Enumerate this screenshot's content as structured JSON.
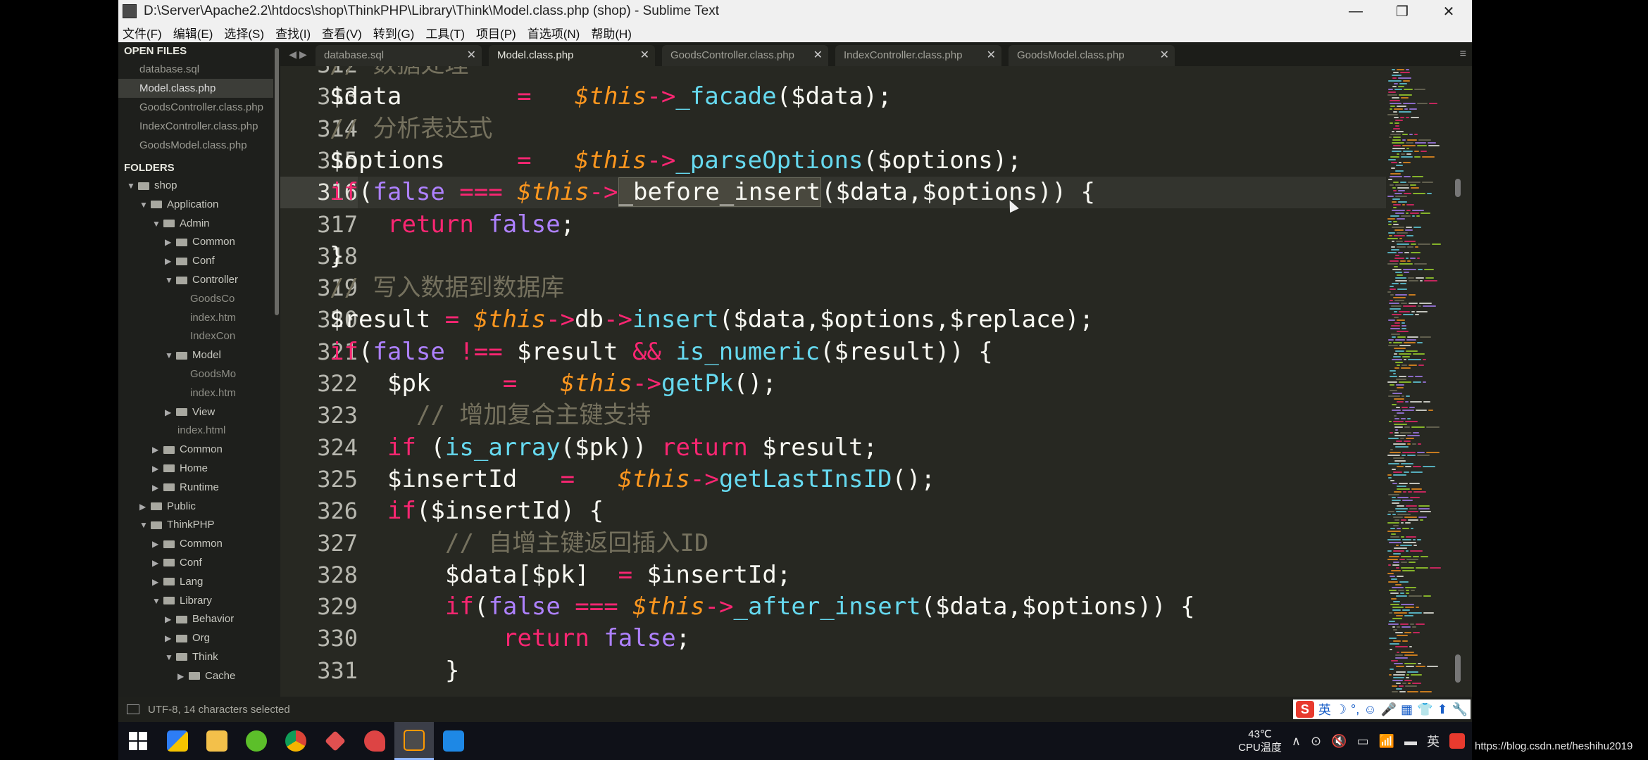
{
  "window": {
    "title": "D:\\Server\\Apache2.2\\htdocs\\shop\\ThinkPHP\\Library\\Think\\Model.class.php (shop) - Sublime Text",
    "controls": [
      "—",
      "❐",
      "✕"
    ]
  },
  "menu": [
    "文件(F)",
    "编辑(E)",
    "选择(S)",
    "查找(I)",
    "查看(V)",
    "转到(G)",
    "工具(T)",
    "项目(P)",
    "首选项(N)",
    "帮助(H)"
  ],
  "sidebar": {
    "open_files_label": "OPEN FILES",
    "open_files": [
      "database.sql",
      "Model.class.php",
      "GoodsController.class.php",
      "IndexController.class.php",
      "GoodsModel.class.php"
    ],
    "active_file_index": 1,
    "folders_label": "FOLDERS",
    "tree": [
      {
        "label": "shop",
        "depth": 0,
        "type": "folder",
        "expanded": true
      },
      {
        "label": "Application",
        "depth": 1,
        "type": "folder",
        "expanded": true
      },
      {
        "label": "Admin",
        "depth": 2,
        "type": "folder",
        "expanded": true
      },
      {
        "label": "Common",
        "depth": 3,
        "type": "folder",
        "expanded": false
      },
      {
        "label": "Conf",
        "depth": 3,
        "type": "folder",
        "expanded": false
      },
      {
        "label": "Controller",
        "depth": 3,
        "type": "folder",
        "expanded": true
      },
      {
        "label": "GoodsCo",
        "depth": 5,
        "type": "file"
      },
      {
        "label": "index.htm",
        "depth": 5,
        "type": "file"
      },
      {
        "label": "IndexCon",
        "depth": 5,
        "type": "file"
      },
      {
        "label": "Model",
        "depth": 3,
        "type": "folder",
        "expanded": true
      },
      {
        "label": "GoodsMo",
        "depth": 5,
        "type": "file"
      },
      {
        "label": "index.htm",
        "depth": 5,
        "type": "file"
      },
      {
        "label": "View",
        "depth": 3,
        "type": "folder",
        "expanded": false
      },
      {
        "label": "index.html",
        "depth": 4,
        "type": "file"
      },
      {
        "label": "Common",
        "depth": 2,
        "type": "folder",
        "expanded": false
      },
      {
        "label": "Home",
        "depth": 2,
        "type": "folder",
        "expanded": false
      },
      {
        "label": "Runtime",
        "depth": 2,
        "type": "folder",
        "expanded": false
      },
      {
        "label": "Public",
        "depth": 1,
        "type": "folder",
        "expanded": false
      },
      {
        "label": "ThinkPHP",
        "depth": 1,
        "type": "folder",
        "expanded": true
      },
      {
        "label": "Common",
        "depth": 2,
        "type": "folder",
        "expanded": false
      },
      {
        "label": "Conf",
        "depth": 2,
        "type": "folder",
        "expanded": false
      },
      {
        "label": "Lang",
        "depth": 2,
        "type": "folder",
        "expanded": false
      },
      {
        "label": "Library",
        "depth": 2,
        "type": "folder",
        "expanded": true
      },
      {
        "label": "Behavior",
        "depth": 3,
        "type": "folder",
        "expanded": false
      },
      {
        "label": "Org",
        "depth": 3,
        "type": "folder",
        "expanded": false
      },
      {
        "label": "Think",
        "depth": 3,
        "type": "folder",
        "expanded": true
      },
      {
        "label": "Cache",
        "depth": 4,
        "type": "folder",
        "expanded": false
      }
    ]
  },
  "tabs": {
    "nav": "◀ ▶",
    "items": [
      "database.sql",
      "Model.class.php",
      "GoodsController.class.php",
      "IndexController.class.php",
      "GoodsModel.class.php"
    ],
    "active_index": 1,
    "close": "✕",
    "menu": "≡"
  },
  "editor": {
    "current_line": 316,
    "lines": [
      {
        "n": "312",
        "indent": 2,
        "tokens": [
          [
            "cm",
            "// 数据处理"
          ]
        ]
      },
      {
        "n": "313",
        "indent": 2,
        "tokens": [
          [
            "",
            "$data        "
          ],
          [
            "kw",
            "="
          ],
          [
            "",
            "   "
          ],
          [
            "th",
            "$this"
          ],
          [
            "kw",
            "->"
          ],
          [
            "fn",
            "_facade"
          ],
          [
            "",
            "($data);"
          ]
        ]
      },
      {
        "n": "314",
        "indent": 2,
        "tokens": [
          [
            "cm",
            "// 分析表达式"
          ]
        ]
      },
      {
        "n": "315",
        "indent": 2,
        "tokens": [
          [
            "",
            "$options     "
          ],
          [
            "kw",
            "="
          ],
          [
            "",
            "   "
          ],
          [
            "th",
            "$this"
          ],
          [
            "kw",
            "->"
          ],
          [
            "fn",
            "_parseOptions"
          ],
          [
            "",
            "($options);"
          ]
        ]
      },
      {
        "n": "316",
        "indent": 2,
        "tokens": [
          [
            "kw",
            "if"
          ],
          [
            "",
            "("
          ],
          [
            "cst",
            "false"
          ],
          [
            "",
            " "
          ],
          [
            "kw",
            "==="
          ],
          [
            "",
            " "
          ],
          [
            "th",
            "$this"
          ],
          [
            "kw",
            "->"
          ],
          [
            "sel",
            "_before_insert"
          ],
          [
            "",
            "($data,$options)) {"
          ]
        ]
      },
      {
        "n": "317",
        "indent": 3,
        "tokens": [
          [
            "kw",
            "return"
          ],
          [
            "",
            " "
          ],
          [
            "cst",
            "false"
          ],
          [
            "",
            ";"
          ]
        ]
      },
      {
        "n": "318",
        "indent": 2,
        "tokens": [
          [
            "",
            "}"
          ]
        ]
      },
      {
        "n": "319",
        "indent": 2,
        "tokens": [
          [
            "cm",
            "// 写入数据到数据库"
          ]
        ]
      },
      {
        "n": "320",
        "indent": 2,
        "tokens": [
          [
            "",
            "$result "
          ],
          [
            "kw",
            "="
          ],
          [
            "",
            " "
          ],
          [
            "th",
            "$this"
          ],
          [
            "kw",
            "->"
          ],
          [
            "",
            "db"
          ],
          [
            "kw",
            "->"
          ],
          [
            "fn",
            "insert"
          ],
          [
            "",
            "($data,$options,$replace);"
          ]
        ]
      },
      {
        "n": "321",
        "indent": 2,
        "tokens": [
          [
            "kw",
            "if"
          ],
          [
            "",
            "("
          ],
          [
            "cst",
            "false"
          ],
          [
            "",
            " "
          ],
          [
            "kw",
            "!=="
          ],
          [
            "",
            " $result "
          ],
          [
            "kw",
            "&&"
          ],
          [
            "",
            " "
          ],
          [
            "fn",
            "is_numeric"
          ],
          [
            "",
            "($result)) {"
          ]
        ]
      },
      {
        "n": "322",
        "indent": 3,
        "tokens": [
          [
            "",
            "$pk     "
          ],
          [
            "kw",
            "="
          ],
          [
            "",
            "   "
          ],
          [
            "th",
            "$this"
          ],
          [
            "kw",
            "->"
          ],
          [
            "fn",
            "getPk"
          ],
          [
            "",
            "();"
          ]
        ]
      },
      {
        "n": "323",
        "indent": 3,
        "tokens": [
          [
            "cm",
            "  // 增加复合主键支持"
          ]
        ]
      },
      {
        "n": "324",
        "indent": 3,
        "tokens": [
          [
            "kw",
            "if"
          ],
          [
            "",
            " ("
          ],
          [
            "fn",
            "is_array"
          ],
          [
            "",
            "($pk)) "
          ],
          [
            "kw",
            "return"
          ],
          [
            "",
            " $result;"
          ]
        ]
      },
      {
        "n": "325",
        "indent": 3,
        "tokens": [
          [
            "",
            "$insertId   "
          ],
          [
            "kw",
            "="
          ],
          [
            "",
            "   "
          ],
          [
            "th",
            "$this"
          ],
          [
            "kw",
            "->"
          ],
          [
            "fn",
            "getLastInsID"
          ],
          [
            "",
            "();"
          ]
        ]
      },
      {
        "n": "326",
        "indent": 3,
        "tokens": [
          [
            "kw",
            "if"
          ],
          [
            "",
            "($insertId) {"
          ]
        ]
      },
      {
        "n": "327",
        "indent": 4,
        "tokens": [
          [
            "cm",
            "// 自增主键返回插入ID"
          ]
        ]
      },
      {
        "n": "328",
        "indent": 4,
        "tokens": [
          [
            "",
            "$data[$pk]  "
          ],
          [
            "kw",
            "="
          ],
          [
            "",
            " $insertId;"
          ]
        ]
      },
      {
        "n": "329",
        "indent": 4,
        "tokens": [
          [
            "kw",
            "if"
          ],
          [
            "",
            "("
          ],
          [
            "cst",
            "false"
          ],
          [
            "",
            " "
          ],
          [
            "kw",
            "==="
          ],
          [
            "",
            " "
          ],
          [
            "th",
            "$this"
          ],
          [
            "kw",
            "->"
          ],
          [
            "fn",
            "_after_insert"
          ],
          [
            "",
            "($data,$options)) {"
          ]
        ]
      },
      {
        "n": "330",
        "indent": 5,
        "tokens": [
          [
            "kw",
            "return"
          ],
          [
            "",
            " "
          ],
          [
            "cst",
            "false"
          ],
          [
            "",
            ";"
          ]
        ]
      },
      {
        "n": "331",
        "indent": 4,
        "tokens": [
          [
            "",
            "}"
          ]
        ]
      }
    ]
  },
  "status": {
    "text": "UTF-8, 14 characters selected"
  },
  "ime": {
    "logo": "S",
    "lang": "英",
    "icons": [
      "☽",
      "°,",
      "☺",
      "🎤",
      "▦",
      "👕",
      "⬆",
      "🔧"
    ]
  },
  "taskbar": {
    "apps": [
      "start-icon",
      "tiles-icon",
      "explorer-icon",
      "360-icon",
      "chrome-icon",
      "pen-icon",
      "snail-icon",
      "sublime-icon",
      "webstorm-icon"
    ],
    "active_index": 7,
    "temp": "43℃",
    "temp_label": "CPU温度",
    "tray_lang": "英",
    "tray_icons": [
      "∧",
      "⊙",
      "🔇",
      "▭",
      "📶",
      "▬"
    ]
  },
  "watermark": "https://blog.csdn.net/heshihu2019",
  "colors": {
    "keyword": "#f92672",
    "constant": "#ae81ff",
    "this": "#fd971f",
    "function": "#66d9ef",
    "comment": "#75715e",
    "background": "#272822"
  }
}
